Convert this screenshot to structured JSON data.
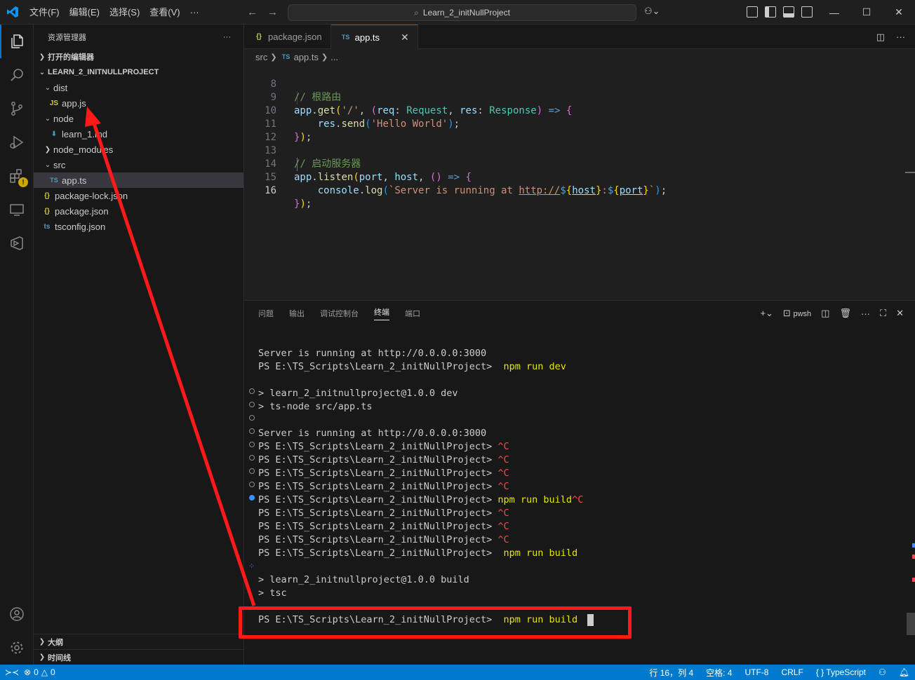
{
  "titlebar": {
    "menu": [
      "文件(F)",
      "编辑(E)",
      "选择(S)",
      "查看(V)",
      "···"
    ],
    "search_text": "Learn_2_initNullProject"
  },
  "sidebar": {
    "title": "资源管理器",
    "more": "···",
    "open_editors": "打开的编辑器",
    "project": "LEARN_2_INITNULLPROJECT",
    "tree": [
      {
        "label": "dist",
        "type": "folder-open"
      },
      {
        "label": "app.js",
        "type": "js",
        "icon": "JS"
      },
      {
        "label": "node",
        "type": "folder-open"
      },
      {
        "label": "learn_1.md",
        "type": "md",
        "icon": "⬇"
      },
      {
        "label": "node_modules",
        "type": "folder-closed"
      },
      {
        "label": "src",
        "type": "folder-open"
      },
      {
        "label": "app.ts",
        "type": "ts",
        "icon": "TS"
      },
      {
        "label": "package-lock.json",
        "type": "json",
        "icon": "{}"
      },
      {
        "label": "package.json",
        "type": "json",
        "icon": "{}"
      },
      {
        "label": "tsconfig.json",
        "type": "tsconfig",
        "icon": "ts"
      }
    ],
    "outline": "大纲",
    "timeline": "时间线"
  },
  "tabs": [
    {
      "label": "package.json",
      "icon": "{}"
    },
    {
      "label": "app.ts",
      "icon": "TS"
    }
  ],
  "breadcrumb": {
    "folder": "src",
    "file": "app.ts",
    "more": "..."
  },
  "editor": {
    "line_numbers": [
      "8",
      "9",
      "10",
      "11",
      "12",
      "13",
      "14",
      "15",
      "16"
    ],
    "l8_comment": "// 根路由",
    "l9_app": "app",
    "l9_get": "get",
    "l9_str": "'/'",
    "l9_req": "req",
    "l9_reqtype": "Request",
    "l9_res": "res",
    "l9_restype": "Response",
    "l10_res": "res",
    "l10_send": "send",
    "l10_str": "'Hello World'",
    "l13_comment": "// 启动服务器",
    "l14_app": "app",
    "l14_listen": "listen",
    "l14_port": "port",
    "l14_host": "host",
    "l15_console": "console",
    "l15_log": "log",
    "l15_str_a": "`Server is running at ",
    "l15_url": "http://",
    "l15_host": "host",
    "l15_port": "port",
    "l15_tick": "`"
  },
  "panel": {
    "tabs": [
      "问题",
      "输出",
      "调试控制台",
      "终端",
      "端口"
    ],
    "active_tab": "终端",
    "shell": "pwsh"
  },
  "terminal": {
    "prompt": "PS E:\\TS_Scripts\\Learn_2_initNullProject>",
    "server_msg": "Server is running at http://0.0.0.0:3000",
    "cmd_dev": "npm run dev",
    "dev_script": "> learn_2_initnullproject@1.0.0 dev",
    "dev_cmd": "> ts-node src/app.ts",
    "ctrl_c": "^C",
    "cmd_build": "npm run build",
    "cmd_build_partial": "npm run build",
    "build_script": "> learn_2_initnullproject@1.0.0 build",
    "build_cmd": "> tsc"
  },
  "statusbar": {
    "errors": "0",
    "warnings": "0",
    "position": "行 16，列 4",
    "indent": "空格: 4",
    "encoding": "UTF-8",
    "eol": "CRLF",
    "language": "TypeScript",
    "language_icon": "{ }"
  },
  "colors": {
    "accent": "#007acc",
    "annotation": "#ff1a1a"
  }
}
